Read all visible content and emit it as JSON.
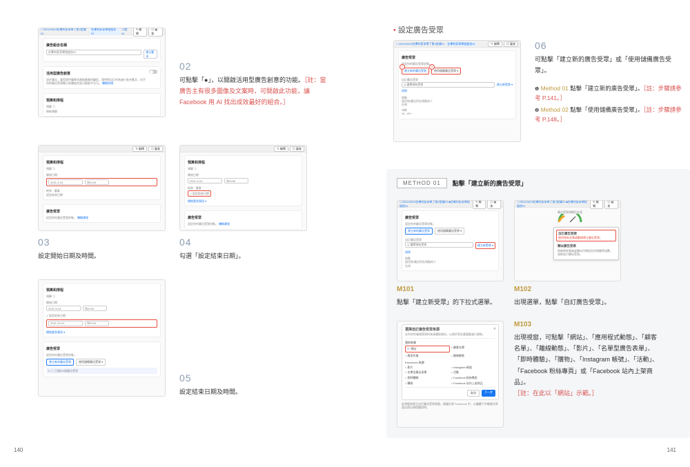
{
  "pageNumbers": {
    "left": "140",
    "right": "141"
  },
  "left": {
    "step02": {
      "num": "02",
      "text_before": "可點擊「",
      "toggle_glyph": "●",
      "text_mid": "」，以開啟活用型廣告創意的功能。",
      "note": "［註：當廣告主有很多圖像及文案時，可開啟此功能，讓 Facebook 用 AI 找出成效最好的組合。］",
      "shot": {
        "crumb1": "□ 2021/09/23在專利家享學了第3堂課01",
        "crumb2": "在專利家享學程組合01",
        "crumb3": "□3堂01",
        "btn_edit": "✎ 編輯",
        "btn_review": "◎ 審查",
        "label_name": "廣告組合名稱",
        "input_name": "在專利家享學程組合01",
        "btn_template": "建立範本",
        "label_dyn": "活用型廣告創意",
        "dyn_desc": "對於廣告，當您提供圖單名稱和最美的圖形，我們將自訂符為進行各合應文，向不同的廣告受眾顯示各種組合面可能能平台可。",
        "dyn_more": "瞭解詳情",
        "label_sched": "預算和排程",
        "sched_sub": "預算 ①",
        "sched_sub2": "總結預算"
      }
    },
    "step03": {
      "num": "03",
      "text": "設定開始日期及時間。",
      "shot": {
        "btn_edit": "✎ 編輯",
        "btn_review": "◎ 審查",
        "label_sched": "預算和排程",
        "label_budget": "預算 ①",
        "label_start": "開始日期",
        "date1": "2021-9-24",
        "time1": "00:00",
        "label_end": "結束 · 選填",
        "chk_end": "設定結束日期",
        "label_aud": "廣告受眾",
        "aud_sub": "設定你的廣告受眾對象。",
        "aud_more": "瞭解課程"
      }
    },
    "step04": {
      "num": "04",
      "text": "勾選「設定結束日期」。",
      "shot": {
        "btn_edit": "✎ 編輯",
        "btn_review": "◎ 審查",
        "label_sched": "預算和排程",
        "label_budget": "預算 ①",
        "label_start": "開始日期",
        "date1": "2021-9-24",
        "time1": "00:00",
        "label_end": "結束 · 選填",
        "chk_end": "✓ 設定結束日期",
        "label_more": "總結更多資訊 ▾",
        "label_aud": "廣告受眾",
        "aud_sub": "設定你的廣告受眾對象。",
        "aud_more": "瞭解課程"
      }
    },
    "step05": {
      "num": "05",
      "text": "設定結束日期及時間。",
      "shot": {
        "label_sched": "預算和排程",
        "label_budget": "預算 ①",
        "label_start": "開始日期",
        "date1": "2021-9-24",
        "time1": "00:00",
        "chk_end": "✓ 設定結束日期",
        "date2": "2021-10-01",
        "time2": "00:00",
        "label_more": "總結更多資訊 ▾",
        "label_aud": "廣告受眾",
        "aud_sub": "設定你的廣告受眾對象。",
        "aud_btn": "建立新的廣告受眾",
        "aud_btn2": "使用儲備廣告受眾 ▾",
        "aud_note": "① 已儲存5個廣告受眾"
      }
    }
  },
  "right": {
    "heading": "設定廣告受眾",
    "bullet": "•",
    "step06": {
      "num": "06",
      "text": "可點擊「建立新的廣告受眾」或「使用儲備廣告受眾」。",
      "methods": [
        {
          "n": "❶",
          "label": "Method 01",
          "t": "點擊「建立新的廣告受眾」。",
          "note": "［註：步驟請參考 P.141。］"
        },
        {
          "n": "❷",
          "label": "Method 02",
          "t": "點擊「使用儲備廣告受眾」。",
          "note": "［註：步驟請參考 P.148。］"
        }
      ],
      "shot": {
        "crumb1": "□ 2021/09/23在專利家享學了第3堂課01",
        "crumb2": "在專利家享學程組合01",
        "btn_edit": "✎ 編輯",
        "btn_review": "◎ 審查",
        "label_aud": "廣告受眾",
        "aud_sub": "設定你的廣告受眾對象。",
        "pill1": "建立新的廣告受眾",
        "pill2": "使用儲備廣告受眾 ▾",
        "label_src": "自訂廣告受眾",
        "src_input": "Q 選擇現有受眾",
        "src_new": "建立新受眾 ▾",
        "label_exclude": "排除",
        "label_loc": "地點",
        "loc_sub": "居住地/最近所在地點的人",
        "loc_val": "台灣",
        "label_age": "年齡",
        "age_val": "18 - 65+"
      }
    },
    "method01_band": {
      "badge": "METHOD 01",
      "title": "點擊「建立新的廣告受眾」"
    },
    "m101": {
      "label": "M101",
      "text": "點擊「建立新受眾」的下拉式選單。",
      "shot": {
        "crumb": "□ 2021/09/23在專利家享學了第3堂課01  ■在專利家享學程組合01",
        "btn_edit": "✎ 編輯",
        "btn_review": "◎ 審查",
        "label_aud": "廣告受眾",
        "aud_sub": "設定你的廣告受眾對象。",
        "pill1": "建立新的廣告受眾",
        "pill2": "使用儲備廣告受眾 ▾",
        "label_src": "自訂廣告受眾",
        "src_input": "Q 選擇現有受眾",
        "src_new": "建立新受眾 ▾",
        "label_exclude": "排除",
        "label_loc": "地點",
        "loc_sub": "居住地/最近所在地點的人",
        "loc_val": "台灣"
      }
    },
    "m102": {
      "label": "M102",
      "text": "出現選單，點擊「自訂廣告受眾」。",
      "shot": {
        "caption_top": "廣告受眾規模估計值",
        "menu1": "自訂廣告受眾",
        "menu1_sub": "使用現有名單或數據建立廣告受眾。",
        "menu2": "類似廣告受眾",
        "menu2_sub": "根據現有會員或類似目標設定的興趣等因數，協助吸引類似受眾。",
        "footnote": "瞭解詳情 ＞"
      }
    },
    "m103": {
      "label": "M103",
      "text_parts": [
        "出現視窗，可點擊「網站」、「應用程式動態」、「顧客名單」、「離線動態」、「影片」、「名單型廣告表單」、「即時體驗」、「購物」、「Instagram 帳號」、「活動」、「Facebook 粉絲專頁」或「Facebook 站內上架商品」。"
      ],
      "note": "［註：在此以「網站」示範。］",
      "shot": {
        "title": "選擇自訂廣告受眾來源",
        "subtitle": "在符合你業務受眾的來源選取資訊，以便於您在最喜歡進行資取。",
        "grp1": "我的來源",
        "opt_web": "網站",
        "opt_app": "應用作業",
        "opt_list": "顧客名單",
        "opt_offline": "離線動態",
        "grp2": "Facebook 來源",
        "opt_video": "影片",
        "opt_ig": "Instagram 帳號",
        "opt_form": "名單型廣告表單",
        "opt_event": "活動",
        "opt_ie": "即時體驗",
        "opt_page": "Facebook 粉絲專頁",
        "opt_shop": "購物",
        "opt_listing": "Facebook 站內上架商品",
        "btn_cancel": "取消",
        "btn_next": "下一步",
        "note": "此視窗為建立自訂廣告受眾視窗，建議在原 Facebook 中，以繼續下步驟操作頁面自然出現提醒說明。"
      }
    }
  }
}
